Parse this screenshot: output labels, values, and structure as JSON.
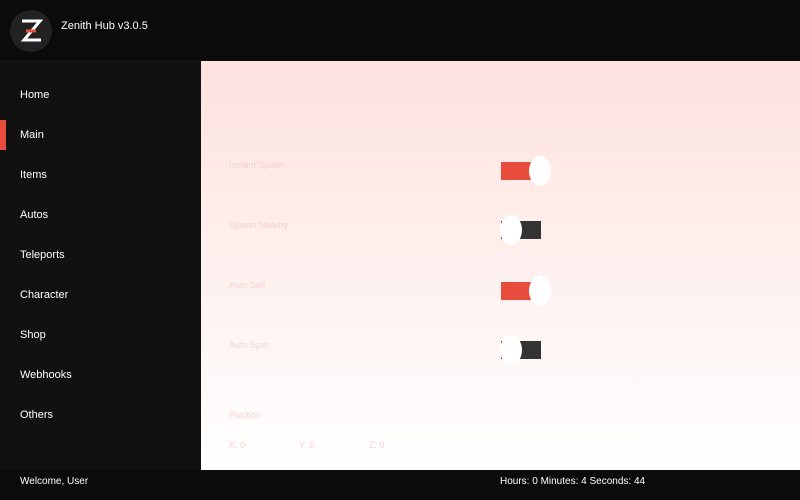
{
  "app": {
    "title": "Zenith Hub v3.0.5",
    "logo_letter": "Z"
  },
  "sidebar": {
    "items": [
      {
        "label": "Home"
      },
      {
        "label": "Main",
        "active": true
      },
      {
        "label": "Items"
      },
      {
        "label": "Autos"
      },
      {
        "label": "Teleports"
      },
      {
        "label": "Character"
      },
      {
        "label": "Shop"
      },
      {
        "label": "Webhooks"
      },
      {
        "label": "Others"
      }
    ]
  },
  "main": {
    "toggles": [
      {
        "label": "Instant Spawn",
        "on": true
      },
      {
        "label": "Spawn Nearby",
        "on": false
      },
      {
        "label": "Auto Sell",
        "on": true
      },
      {
        "label": "Auto Spin",
        "on": false
      }
    ],
    "position": {
      "label": "Position",
      "x": "X: 0",
      "y": "Y: 0",
      "z": "Z: 0"
    }
  },
  "footer": {
    "welcome": "Welcome, User",
    "timer": "Hours: 0 Minutes: 4 Seconds: 44"
  },
  "colors": {
    "accent": "#e74c3c",
    "toggle_off": "#333333",
    "background": "#0b0b0b",
    "sidebar": "#111111"
  },
  "icons": {
    "logo": "zenith-logo-icon"
  }
}
